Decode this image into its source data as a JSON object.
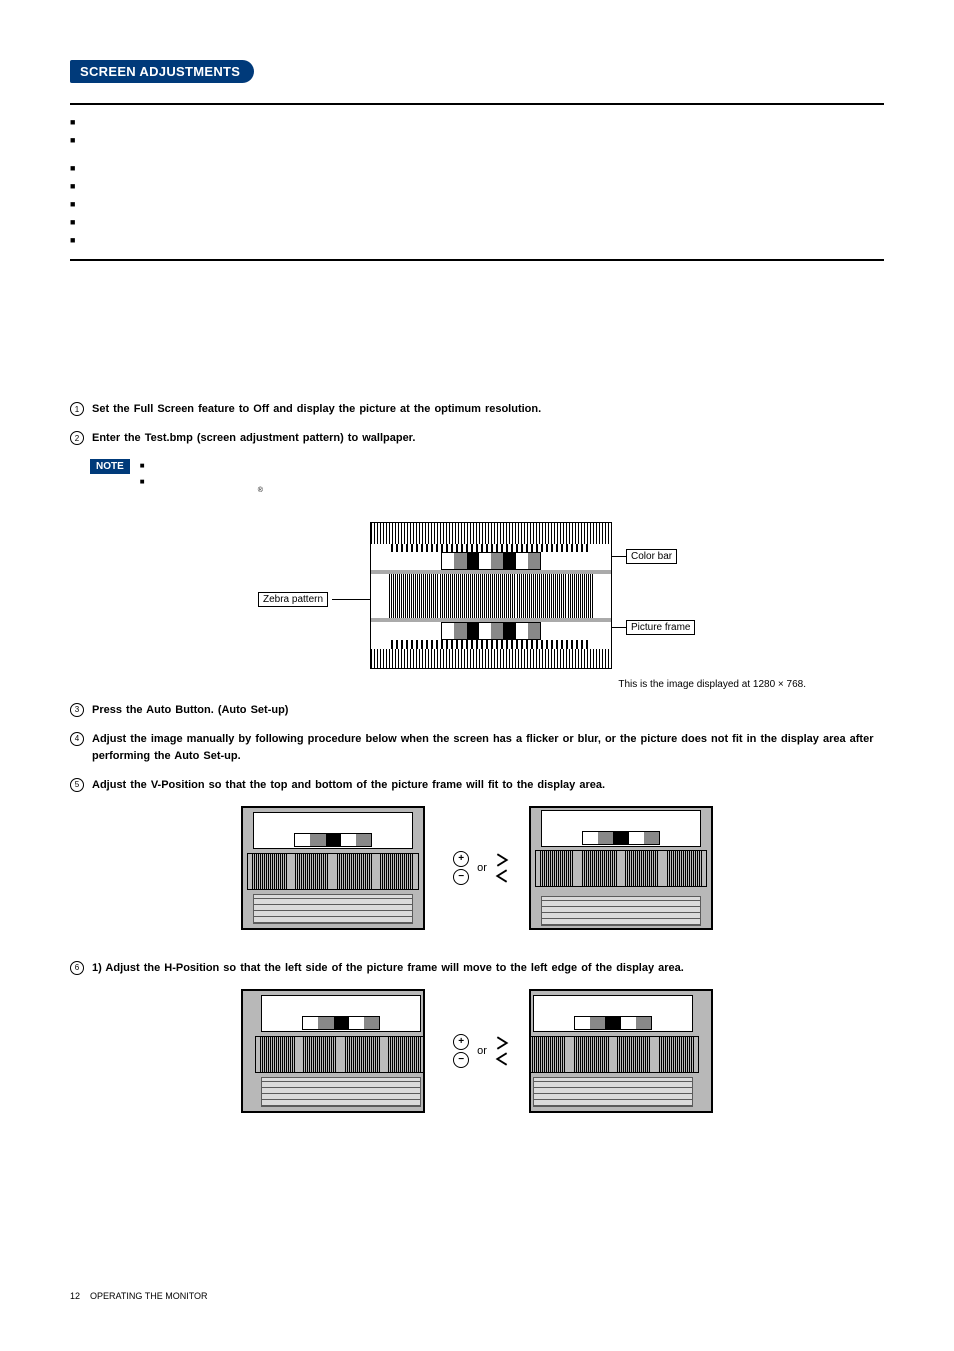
{
  "section_title": "SCREEN ADJUSTMENTS",
  "steps": {
    "s1_num": "1",
    "s1_text": "Set the Full Screen feature to Off and display the picture at the optimum resolution.",
    "s2_num": "2",
    "s2_text": "Enter the Test.bmp (screen adjustment pattern) to wallpaper.",
    "s3_num": "3",
    "s3_text": "Press the Auto Button. (Auto Set-up)",
    "s4_num": "4",
    "s4_text": "Adjust the image manually by following procedure below when the screen has a flicker or blur, or the picture does not fit in the display area after performing the Auto Set-up.",
    "s5_num": "5",
    "s5_text": "Adjust the V-Position so that the top and bottom of the picture frame will fit to the display area.",
    "s6_num": "6",
    "s6_text": "1) Adjust the H-Position so that the left side of the picture frame will move to the left edge of the display area."
  },
  "note_label": "NOTE",
  "diagram": {
    "zebra_label": "Zebra pattern",
    "colorbar_label": "Color bar",
    "frame_label": "Picture frame",
    "caption": "This is the image displayed at 1280 × 768."
  },
  "controls": {
    "or": "or"
  },
  "footer": {
    "page": "12",
    "section": "OPERATING THE MONITOR"
  }
}
